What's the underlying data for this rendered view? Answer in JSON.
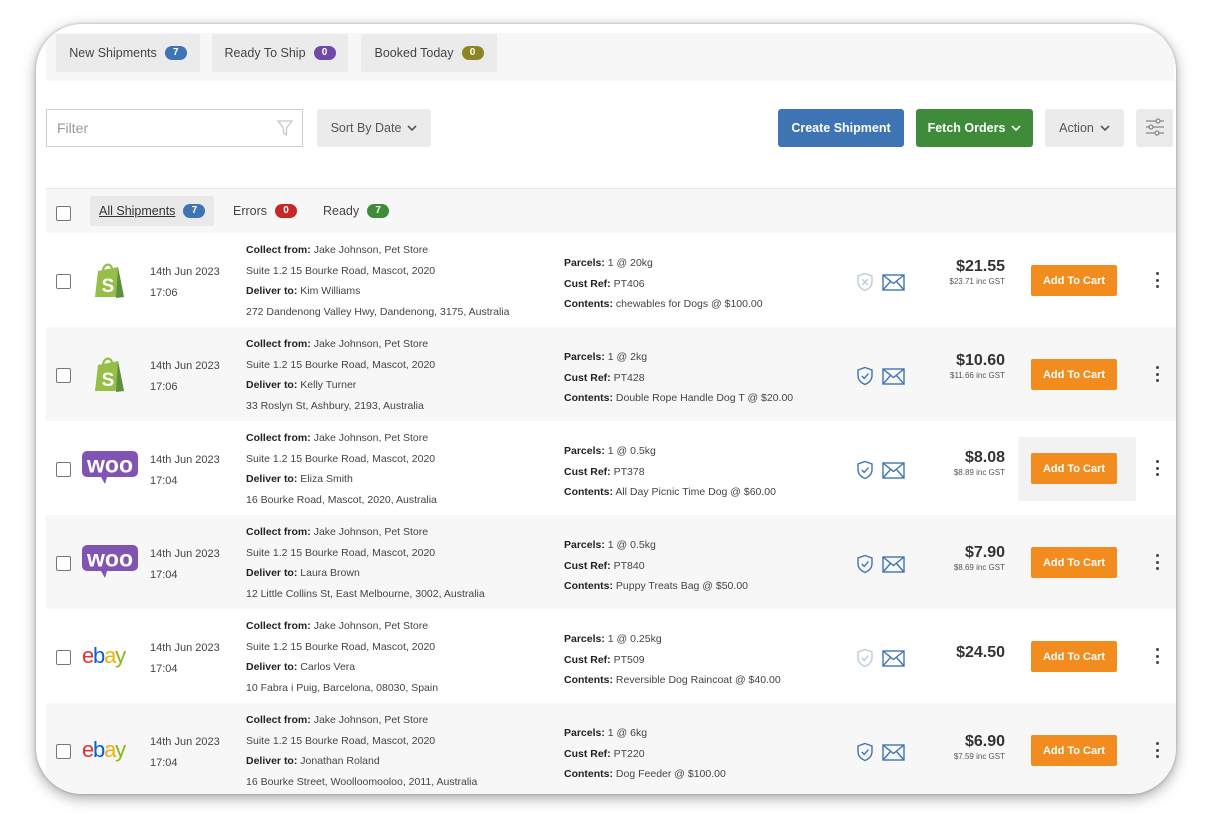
{
  "colors": {
    "blue": "#3f74b4",
    "purple": "#6d4aa5",
    "olive": "#8d8522",
    "red": "#c62828",
    "green": "#3e8c3a",
    "orange": "#f28c1f"
  },
  "top_tabs": [
    {
      "label": "New Shipments",
      "count": "7",
      "color": "#3f74b4"
    },
    {
      "label": "Ready To Ship",
      "count": "0",
      "color": "#6d4aa5"
    },
    {
      "label": "Booked Today",
      "count": "0",
      "color": "#8d8522"
    }
  ],
  "toolbar": {
    "filter_placeholder": "Filter",
    "filter_icon": "funnel-icon",
    "sort_label": "Sort By Date",
    "create_label": "Create Shipment",
    "fetch_label": "Fetch Orders",
    "action_label": "Action",
    "settings_icon": "sliders-icon"
  },
  "sub_tabs": [
    {
      "label": "All Shipments",
      "count": "7",
      "color": "#3f74b4"
    },
    {
      "label": "Errors",
      "count": "0",
      "color": "#c62828"
    },
    {
      "label": "Ready",
      "count": "7",
      "color": "#3e8c3a"
    }
  ],
  "labels": {
    "collect_from": "Collect from:",
    "deliver_to": "Deliver to:",
    "parcels": "Parcels:",
    "cust_ref": "Cust Ref:",
    "contents": "Contents:",
    "add_to_cart": "Add To Cart"
  },
  "shipments": [
    {
      "platform": "shopify-logo",
      "date": "14th Jun 2023",
      "time": "17:06",
      "collect_from": "Jake Johnson, Pet Store",
      "collect_address": "Suite 1.2 15 Bourke Road, Mascot, 2020",
      "deliver_to": "Kim Williams",
      "deliver_address": "272 Dandenong Valley Hwy, Dandenong, 3175, Australia",
      "parcels": "1 @ 20kg",
      "cust_ref": "PT406",
      "contents": "chewables for Dogs @ $100.00",
      "insurance_icon": "shield-x-icon",
      "price": "$21.55",
      "price_gst": "$23.71 inc GST"
    },
    {
      "platform": "shopify-logo",
      "date": "14th Jun 2023",
      "time": "17:06",
      "collect_from": "Jake Johnson, Pet Store",
      "collect_address": "Suite 1.2 15 Bourke Road, Mascot, 2020",
      "deliver_to": "Kelly Turner",
      "deliver_address": "33 Roslyn St, Ashbury, 2193, Australia",
      "parcels": "1 @ 2kg",
      "cust_ref": "PT428",
      "contents": "Double Rope Handle Dog T @ $20.00",
      "insurance_icon": "shield-check-icon",
      "price": "$10.60",
      "price_gst": "$11.66 inc GST"
    },
    {
      "platform": "woo-logo",
      "date": "14th Jun 2023",
      "time": "17:04",
      "collect_from": "Jake Johnson, Pet Store",
      "collect_address": "Suite 1.2 15 Bourke Road, Mascot, 2020",
      "deliver_to": "Eliza Smith",
      "deliver_address": "16 Bourke Road, Mascot, 2020, Australia",
      "parcels": "1 @ 0.5kg",
      "cust_ref": "PT378",
      "contents": "All Day Picnic Time Dog @ $60.00",
      "insurance_icon": "shield-check-icon",
      "price": "$8.08",
      "price_gst": "$8.89 inc GST"
    },
    {
      "platform": "woo-logo",
      "date": "14th Jun 2023",
      "time": "17:04",
      "collect_from": "Jake Johnson, Pet Store",
      "collect_address": "Suite 1.2 15 Bourke Road, Mascot, 2020",
      "deliver_to": "Laura Brown",
      "deliver_address": "12 Little Collins St, East Melbourne, 3002, Australia",
      "parcels": "1 @ 0.5kg",
      "cust_ref": "PT840",
      "contents": "Puppy Treats Bag @ $50.00",
      "insurance_icon": "shield-check-icon",
      "price": "$7.90",
      "price_gst": "$8.69 inc GST"
    },
    {
      "platform": "ebay-logo",
      "date": "14th Jun 2023",
      "time": "17:04",
      "collect_from": "Jake Johnson, Pet Store",
      "collect_address": "Suite 1.2 15 Bourke Road, Mascot, 2020",
      "deliver_to": "Carlos Vera",
      "deliver_address": "10 Fabra i Puig, Barcelona, 08030, Spain",
      "parcels": "1 @ 0.25kg",
      "cust_ref": "PT509",
      "contents": "Reversible Dog Raincoat @ $40.00",
      "insurance_icon": "shield-check-faded-icon",
      "price": "$24.50",
      "price_gst": ""
    },
    {
      "platform": "ebay-logo",
      "date": "14th Jun 2023",
      "time": "17:04",
      "collect_from": "Jake Johnson, Pet Store",
      "collect_address": "Suite 1.2 15 Bourke Road, Mascot, 2020",
      "deliver_to": "Jonathan Roland",
      "deliver_address": "16 Bourke Street, Woolloomooloo, 2011, Australia",
      "parcels": "1 @ 6kg",
      "cust_ref": "PT220",
      "contents": "Dog Feeder @ $100.00",
      "insurance_icon": "shield-check-icon",
      "price": "$6.90",
      "price_gst": "$7.59 inc GST"
    }
  ]
}
